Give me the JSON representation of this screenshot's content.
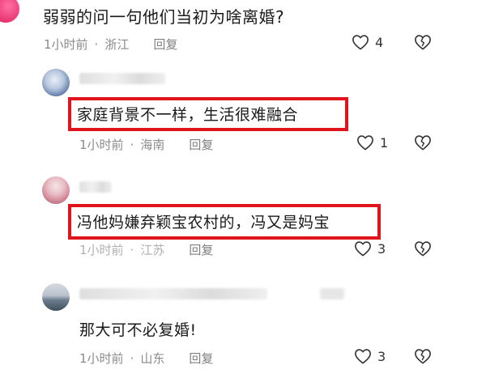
{
  "comments": [
    {
      "text": "弱弱的问一句他们当初为啥离婚?",
      "time": "1小时前",
      "location": "浙江",
      "reply_label": "回复",
      "likes": "4"
    },
    {
      "text": "家庭背景不一样，生活很难融合",
      "time": "1小时前",
      "location": "海南",
      "reply_label": "回复",
      "likes": "1"
    },
    {
      "text": "冯他妈嫌弃颖宝农村的，冯又是妈宝",
      "time": "1小时前",
      "location": "江苏",
      "reply_label": "回复",
      "likes": "3"
    },
    {
      "text": "那大可不必复婚!",
      "time": "1小时前",
      "location": "山东",
      "reply_label": "回复",
      "likes": "3"
    }
  ],
  "colors": {
    "highlight": "#e0141c",
    "meta_text": "#8a8a8a"
  },
  "icons": {
    "like": "heart-outline-icon",
    "dislike": "broken-heart-icon"
  }
}
